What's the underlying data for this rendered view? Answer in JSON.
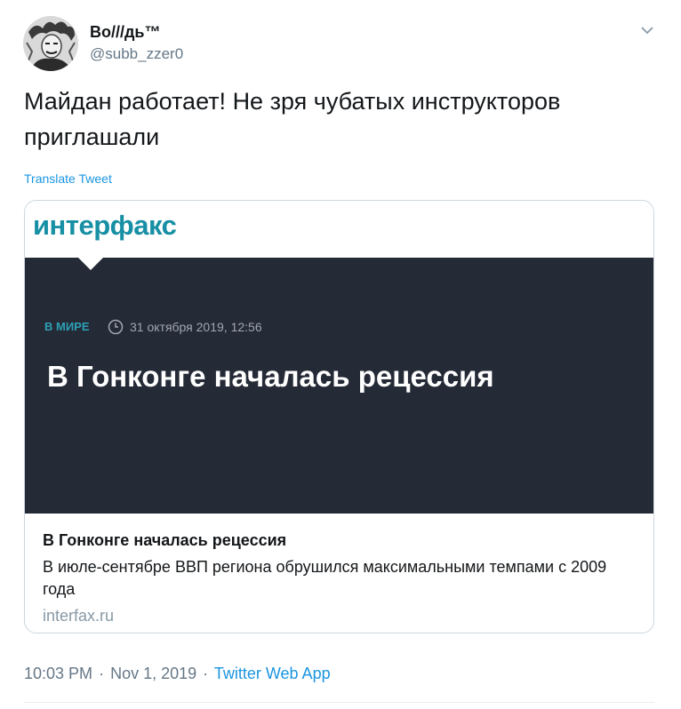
{
  "author": {
    "display_name": "Во///дь™",
    "handle": "@subb_zzer0"
  },
  "tweet": {
    "text": "Майдан работает! Не зря чубатых инструкторов\nприглашали",
    "translate_label": "Translate Tweet"
  },
  "card": {
    "brand": "интерфакс",
    "category": "В МИРЕ",
    "date": "31 октября 2019, 12:56",
    "headline": "В Гонконге началась рецессия",
    "title": "В Гонконге началась рецессия",
    "description": "В июле-сентябре ВВП региона обрушился максимальными темпами с 2009 года",
    "domain": "interfax.ru"
  },
  "meta": {
    "time": "10:03 PM",
    "separator": "·",
    "date": "Nov 1, 2019",
    "source": "Twitter Web App"
  },
  "icons": {
    "caret": "chevron-down-icon",
    "clock": "clock-icon"
  },
  "colors": {
    "link": "#1b95e0",
    "brand": "#178fa4",
    "card_dark": "#252a37",
    "muted": "#657786"
  }
}
